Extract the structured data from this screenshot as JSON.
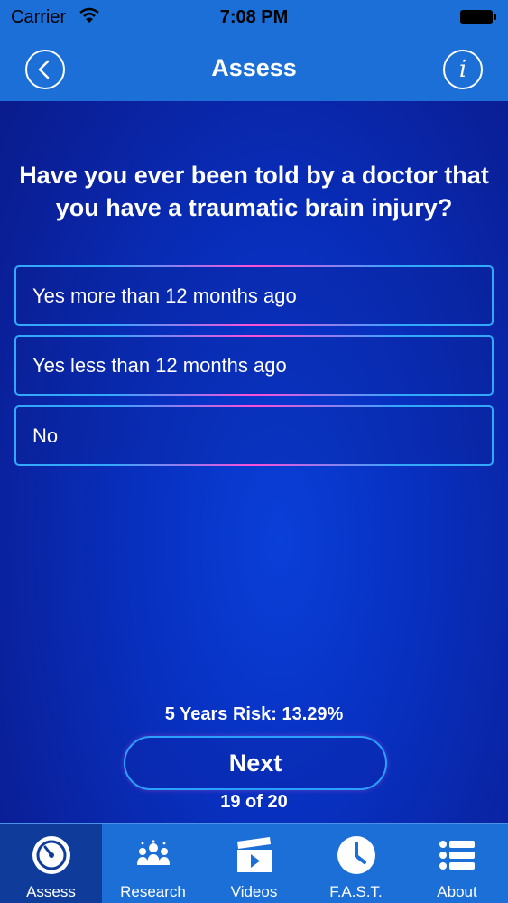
{
  "status_bar": {
    "carrier": "Carrier",
    "time": "7:08 PM",
    "icons": [
      "wifi-icon",
      "battery-icon"
    ]
  },
  "nav": {
    "title": "Assess",
    "back_icon": "chevron-left-icon",
    "info_icon": "info-icon",
    "info_glyph": "i"
  },
  "question": "Have you ever been told by a doctor that you have a traumatic brain injury?",
  "options": [
    {
      "label": "Yes more than 12 months ago"
    },
    {
      "label": "Yes less than 12 months ago"
    },
    {
      "label": "No"
    }
  ],
  "risk": "5 Years Risk: 13.29%",
  "next_label": "Next",
  "progress": "19 of 20",
  "tabs": [
    {
      "label": "Assess",
      "icon": "gauge-icon",
      "active": true
    },
    {
      "label": "Research",
      "icon": "people-icon",
      "active": false
    },
    {
      "label": "Videos",
      "icon": "clapperboard-icon",
      "active": false
    },
    {
      "label": "F.A.S.T.",
      "icon": "clock-icon",
      "active": false
    },
    {
      "label": "About",
      "icon": "list-icon",
      "active": false
    }
  ],
  "colors": {
    "bar_blue": "#1c6fd6",
    "option_border": "#32a8ff",
    "option_glow": "#ff4fd8",
    "active_tab": "#0f3c9a"
  }
}
